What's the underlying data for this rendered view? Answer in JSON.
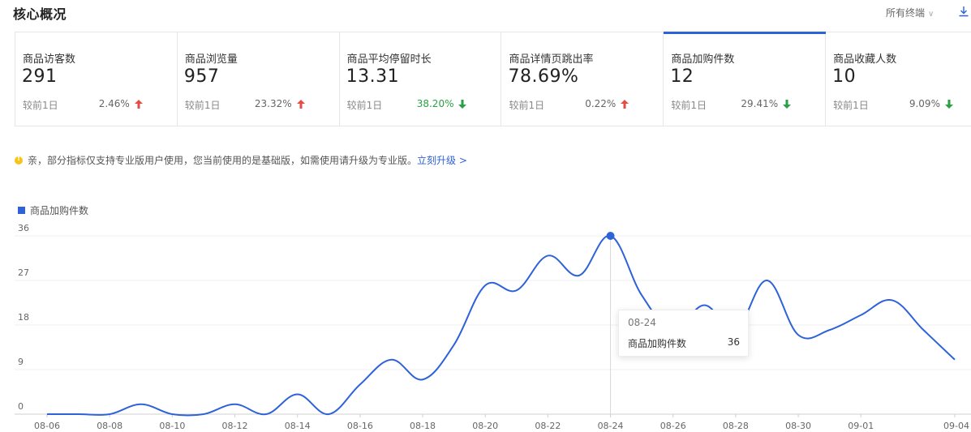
{
  "header": {
    "title": "核心概况",
    "terminal_select": "所有终端",
    "icons": {
      "dropdown": "chevron-down-icon",
      "download": "download-icon"
    }
  },
  "metrics": [
    {
      "name": "商品访客数",
      "value": "291",
      "compare_label": "较前1日",
      "change": "2.46%",
      "direction": "up"
    },
    {
      "name": "商品浏览量",
      "value": "957",
      "compare_label": "较前1日",
      "change": "23.32%",
      "direction": "up"
    },
    {
      "name": "商品平均停留时长",
      "value": "13.31",
      "compare_label": "较前1日",
      "change": "38.20%",
      "direction": "down"
    },
    {
      "name": "商品详情页跳出率",
      "value": "78.69%",
      "compare_label": "较前1日",
      "change": "0.22%",
      "direction": "up"
    },
    {
      "name": "商品加购件数",
      "value": "12",
      "compare_label": "较前1日",
      "change": "29.41%",
      "direction": "down",
      "active": true
    },
    {
      "name": "商品收藏人数",
      "value": "10",
      "compare_label": "较前1日",
      "change": "9.09%",
      "direction": "down"
    }
  ],
  "notice": {
    "text": "亲，部分指标仅支持专业版用户使用，您当前使用的是基础版，如需使用请升级为专业版。",
    "link": "立刻升级 >",
    "icon": "warning-dot-icon"
  },
  "chart_data": {
    "type": "line",
    "title": "",
    "xlabel": "",
    "ylabel": "",
    "legend": "top-left",
    "grid": true,
    "ylim": [
      0,
      36
    ],
    "yticks": [
      "0",
      "9",
      "18",
      "27",
      "36"
    ],
    "xtick_labels": [
      "08-06",
      "08-08",
      "08-10",
      "08-12",
      "08-14",
      "08-16",
      "08-18",
      "08-20",
      "08-22",
      "08-24",
      "08-26",
      "08-28",
      "08-30",
      "09-01",
      "09-04"
    ],
    "x": [
      "08-06",
      "08-07",
      "08-08",
      "08-09",
      "08-10",
      "08-11",
      "08-12",
      "08-13",
      "08-14",
      "08-15",
      "08-16",
      "08-17",
      "08-18",
      "08-19",
      "08-20",
      "08-21",
      "08-22",
      "08-23",
      "08-24",
      "08-25",
      "08-26",
      "08-27",
      "08-28",
      "08-29",
      "08-30",
      "08-31",
      "09-01",
      "09-02",
      "09-03",
      "09-04"
    ],
    "series": [
      {
        "name": "商品加购件数",
        "color": "#2e62d9",
        "values": [
          0,
          0,
          0,
          2,
          0,
          0,
          2,
          0,
          4,
          0,
          6,
          11,
          7,
          14,
          26,
          25,
          32,
          28,
          36,
          24,
          17,
          22,
          17,
          27,
          16,
          17,
          20,
          23,
          17,
          11
        ]
      }
    ]
  },
  "tooltip": {
    "date": "08-24",
    "label": "商品加购件数",
    "value": "36"
  },
  "colors": {
    "accent": "#2e62d9",
    "up": "#e34d44",
    "down": "#2aa046"
  }
}
